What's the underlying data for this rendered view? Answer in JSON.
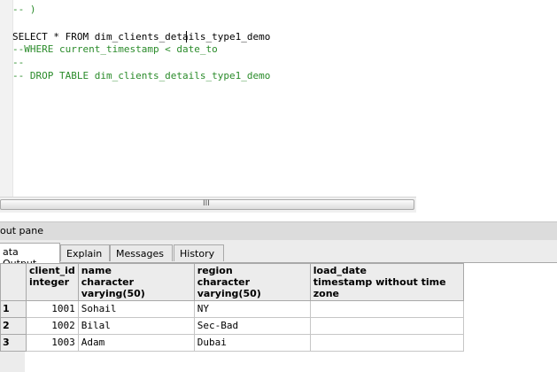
{
  "editor": {
    "lines": [
      {
        "text": "-- )",
        "type": "comment"
      },
      {
        "text": "",
        "type": "code"
      },
      {
        "text": "SELECT * FROM dim_clients_details_type1_demo",
        "type": "code"
      },
      {
        "text": "--WHERE current_timestamp < date_to",
        "type": "comment"
      },
      {
        "text": "--",
        "type": "comment"
      },
      {
        "text": "-- DROP TABLE dim_clients_details_type1_demo",
        "type": "comment"
      }
    ],
    "comment_color": "#2a8b2a"
  },
  "scrollbar": {
    "grip": "III"
  },
  "output_pane": {
    "title": "out pane",
    "tabs": [
      {
        "label": "ata Output",
        "active": true
      },
      {
        "label": "Explain",
        "active": false
      },
      {
        "label": "Messages",
        "active": false
      },
      {
        "label": "History",
        "active": false
      }
    ]
  },
  "grid": {
    "columns": [
      {
        "name": "client_id",
        "type": "integer"
      },
      {
        "name": "name",
        "type": "character varying(50)"
      },
      {
        "name": "region",
        "type": "character varying(50)"
      },
      {
        "name": "load_date",
        "type": "timestamp without time zone"
      }
    ],
    "rows": [
      {
        "rownum": "1",
        "client_id": "1001",
        "name": "Sohail",
        "region": "NY",
        "load_date": ""
      },
      {
        "rownum": "2",
        "client_id": "1002",
        "name": "Bilal",
        "region": "Sec-Bad",
        "load_date": ""
      },
      {
        "rownum": "3",
        "client_id": "1003",
        "name": "Adam",
        "region": "Dubai",
        "load_date": ""
      }
    ]
  }
}
